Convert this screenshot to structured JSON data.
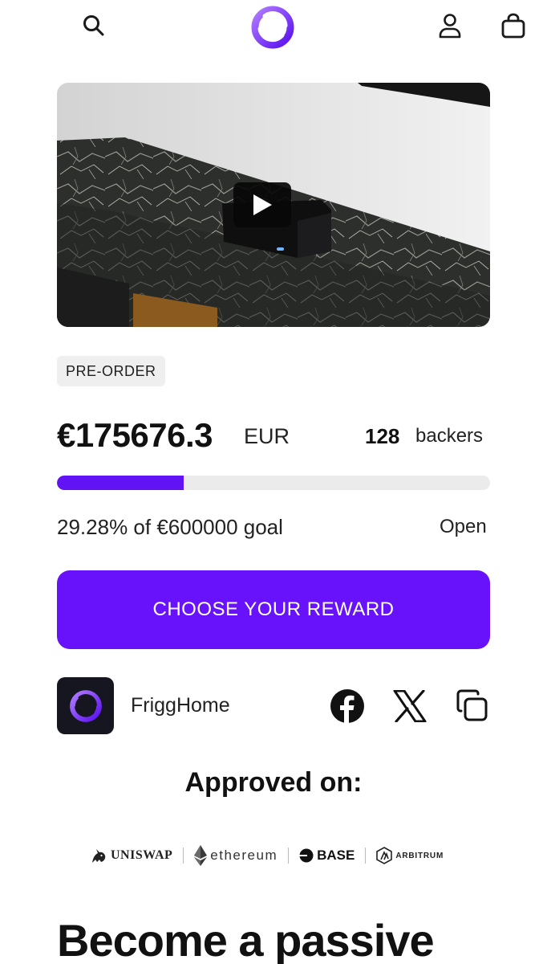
{
  "header": {
    "search_icon": "search-icon",
    "logo_icon": "brand-logo",
    "account_icon": "account-icon",
    "cart_icon": "shopping-bag-icon"
  },
  "video": {
    "play_icon": "play-icon"
  },
  "campaign": {
    "badge": "PRE-ORDER",
    "amount": "€175676.3",
    "currency": "EUR",
    "backers_count": "128",
    "backers_label": "backers",
    "progress_fraction": 0.2928,
    "goal_text": "29.28% of €600000 goal",
    "status": "Open",
    "cta_label": "CHOOSE YOUR REWARD"
  },
  "creator": {
    "name": "FriggHome",
    "share_icons": [
      "facebook-icon",
      "x-icon",
      "copy-link-icon"
    ]
  },
  "approved": {
    "title": "Approved on:",
    "partners": [
      "UNISWAP",
      "ethereum",
      "BASE",
      "ARBITRUM"
    ]
  },
  "headline": "Become a passive",
  "colors": {
    "accent": "#6812fb",
    "progress_fill": "#6213f5",
    "progress_track": "#ebebeb",
    "badge_bg": "#efefef"
  }
}
